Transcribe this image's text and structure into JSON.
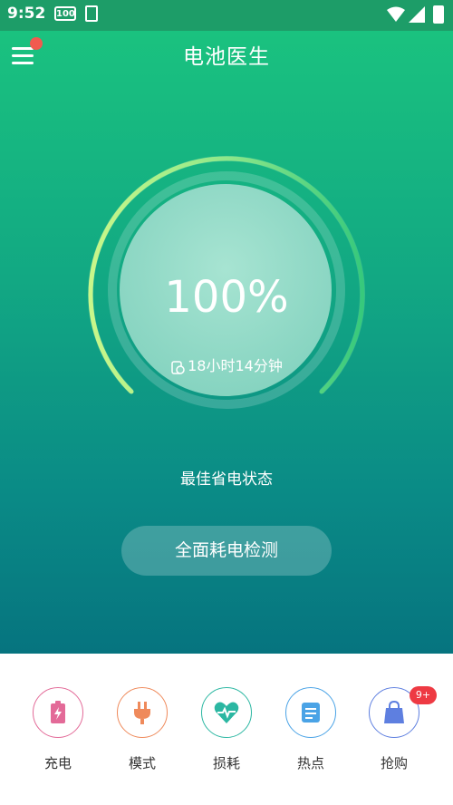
{
  "statusbar": {
    "time": "9:52",
    "battery_text": "100"
  },
  "header": {
    "title": "电池医生",
    "menu_icon": "menu-icon"
  },
  "battery": {
    "percent_text": "100%",
    "remaining": "18小时14分钟",
    "level": 1.0
  },
  "status_text": "最佳省电状态",
  "detect_button": "全面耗电检测",
  "nav": {
    "items": [
      {
        "label": "充电",
        "icon": "charge-icon",
        "color": "#e36a98"
      },
      {
        "label": "模式",
        "icon": "plug-icon",
        "color": "#ef8a5b"
      },
      {
        "label": "损耗",
        "icon": "heartbeat-icon",
        "color": "#2bb7a2"
      },
      {
        "label": "热点",
        "icon": "news-icon",
        "color": "#4aa3e6"
      },
      {
        "label": "抢购",
        "icon": "shopping-bag-icon",
        "color": "#5e7fe0"
      }
    ],
    "badge": "9+"
  },
  "colors": {
    "hero_top": "#1ac27f",
    "hero_bottom": "#06747f",
    "badge": "#ee3a43"
  }
}
